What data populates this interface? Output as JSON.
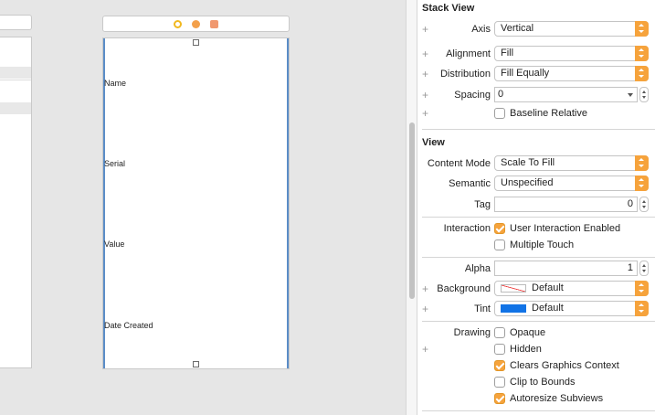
{
  "canvas": {
    "stack_labels": [
      "Name",
      "Serial",
      "Value",
      "Date Created"
    ]
  },
  "inspector": {
    "stack_view": {
      "title": "Stack View",
      "axis_label": "Axis",
      "axis_value": "Vertical",
      "alignment_label": "Alignment",
      "alignment_value": "Fill",
      "distribution_label": "Distribution",
      "distribution_value": "Fill Equally",
      "spacing_label": "Spacing",
      "spacing_value": "0",
      "baseline_label": "Baseline Relative",
      "baseline_checked": false
    },
    "view": {
      "title": "View",
      "content_mode_label": "Content Mode",
      "content_mode_value": "Scale To Fill",
      "semantic_label": "Semantic",
      "semantic_value": "Unspecified",
      "tag_label": "Tag",
      "tag_value": "0",
      "interaction_label": "Interaction",
      "user_interaction_label": "User Interaction Enabled",
      "user_interaction_checked": true,
      "multiple_touch_label": "Multiple Touch",
      "multiple_touch_checked": false,
      "alpha_label": "Alpha",
      "alpha_value": "1",
      "background_label": "Background",
      "background_value": "Default",
      "tint_label": "Tint",
      "tint_value": "Default",
      "tint_color": "#1173e6",
      "drawing_label": "Drawing",
      "opaque_label": "Opaque",
      "opaque_checked": false,
      "hidden_label": "Hidden",
      "hidden_checked": false,
      "clears_label": "Clears Graphics Context",
      "clears_checked": true,
      "clip_label": "Clip to Bounds",
      "clip_checked": false,
      "autoresize_label": "Autoresize Subviews",
      "autoresize_checked": true
    },
    "accent_color": "#f6a33c"
  }
}
